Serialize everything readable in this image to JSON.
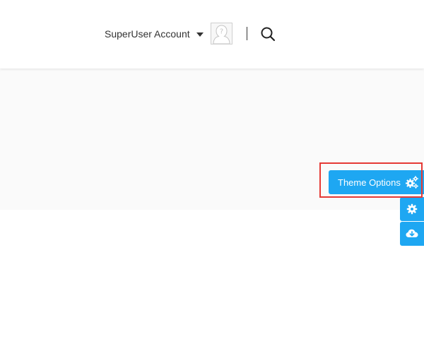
{
  "header": {
    "account_label": "SuperUser Account",
    "account_caret_icon": "caret-down-icon",
    "avatar_icon": "default-avatar-question-icon",
    "search_icon": "search-icon"
  },
  "side_tools": {
    "theme_options_label": "Theme Options",
    "theme_options_icon": "cogs-icon",
    "settings_icon": "gear-icon",
    "download_icon": "cloud-download-icon"
  },
  "colors": {
    "accent": "#1ea7f2",
    "highlight": "#e53935",
    "text": "#333333",
    "band": "#fafafa"
  }
}
